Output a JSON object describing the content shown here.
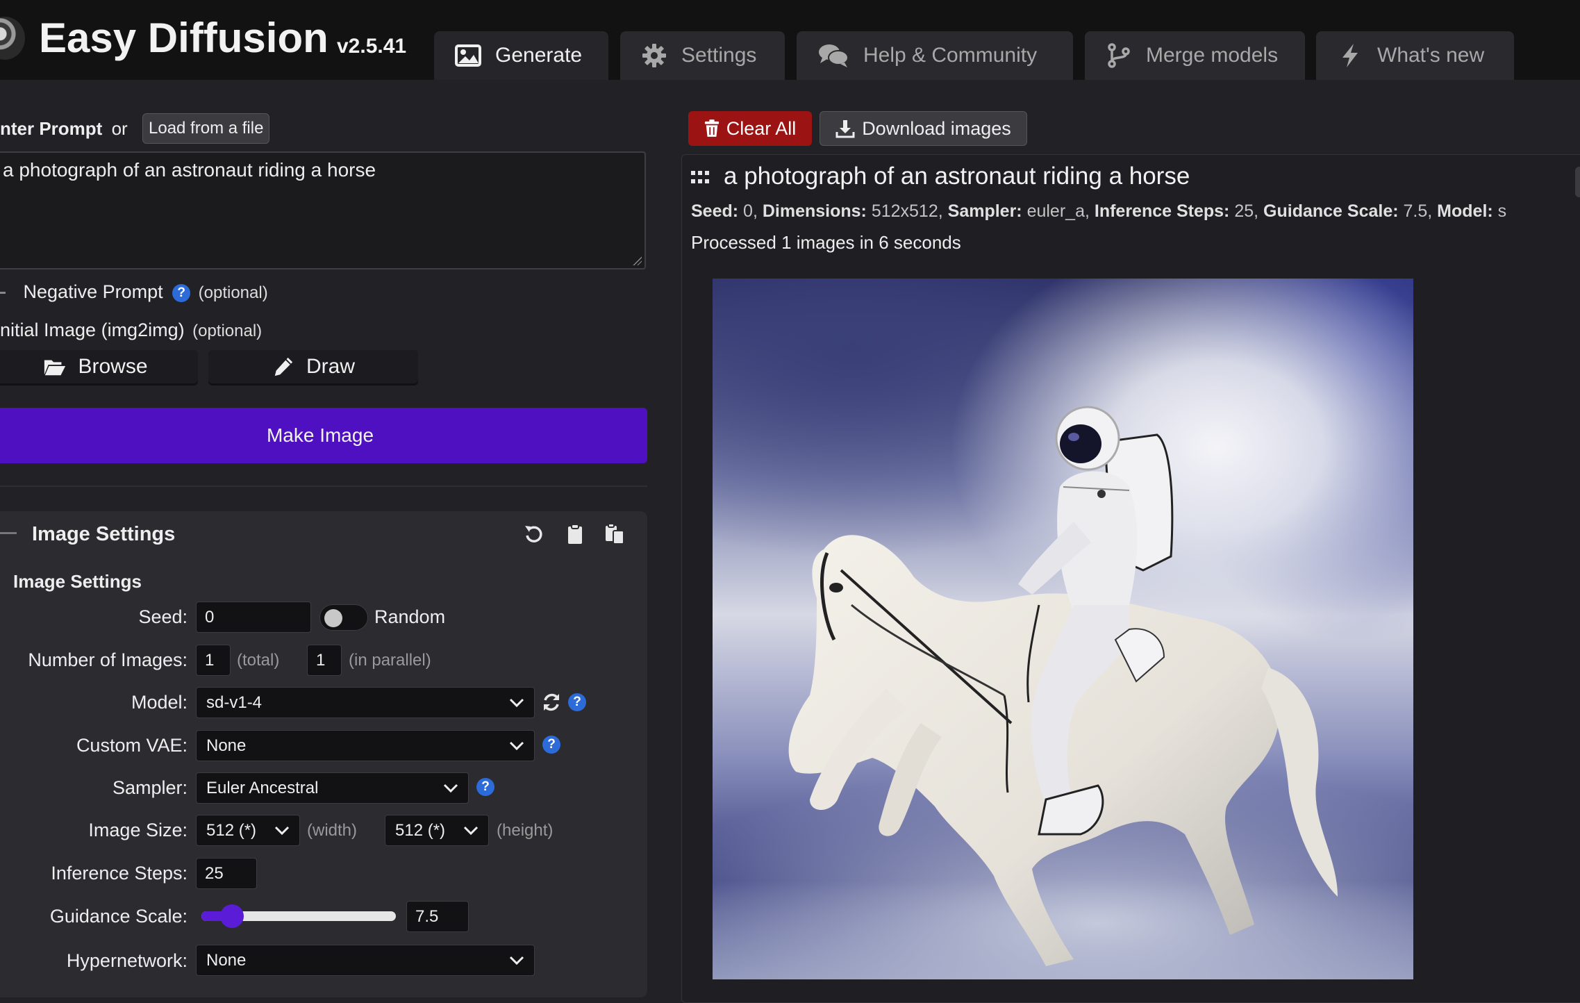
{
  "header": {
    "title": "Easy Diffusion",
    "version": "v2.5.41",
    "tabs": [
      {
        "label": "Generate",
        "icon": "image-icon",
        "active": true
      },
      {
        "label": "Settings",
        "icon": "gear-icon",
        "active": false
      },
      {
        "label": "Help & Community",
        "icon": "comments-icon",
        "active": false
      },
      {
        "label": "Merge models",
        "icon": "code-branch-icon",
        "active": false
      },
      {
        "label": "What's new",
        "icon": "bolt-icon",
        "active": false
      }
    ]
  },
  "prompt": {
    "label_bold": "nter Prompt",
    "label_or": "or",
    "load_button": "Load from a file",
    "value": "a photograph of an astronaut riding a horse"
  },
  "negative": {
    "label": "Negative Prompt",
    "help": "?",
    "optional": "(optional)"
  },
  "init_image": {
    "label": "nitial Image (img2img)",
    "optional": "(optional)",
    "browse": "Browse",
    "draw": "Draw"
  },
  "make_image": "Make Image",
  "image_settings": {
    "card_title": "Image Settings",
    "sub_title": "Image Settings",
    "seed": {
      "label": "Seed:",
      "value": "0",
      "random_label": "Random"
    },
    "num_images": {
      "label": "Number of Images:",
      "total": "1",
      "total_hint": "(total)",
      "parallel": "1",
      "parallel_hint": "(in parallel)"
    },
    "model": {
      "label": "Model:",
      "value": "sd-v1-4"
    },
    "vae": {
      "label": "Custom VAE:",
      "value": "None"
    },
    "sampler": {
      "label": "Sampler:",
      "value": "Euler Ancestral"
    },
    "image_size": {
      "label": "Image Size:",
      "width": "512 (*)",
      "width_hint": "(width)",
      "height": "512 (*)",
      "height_hint": "(height)"
    },
    "steps": {
      "label": "Inference Steps:",
      "value": "25"
    },
    "guidance": {
      "label": "Guidance Scale:",
      "value": "7.5",
      "slider_fraction": 0.13
    },
    "hypernetwork": {
      "label": "Hypernetwork:",
      "value": "None"
    }
  },
  "output": {
    "clear_all": "Clear All",
    "download": "Download images",
    "task_prompt": "a photograph of an astronaut riding a horse",
    "info": [
      {
        "k": "Seed:",
        "v": "0,"
      },
      {
        "k": "Dimensions:",
        "v": "512x512,"
      },
      {
        "k": "Sampler:",
        "v": "euler_a,"
      },
      {
        "k": "Inference Steps:",
        "v": "25,"
      },
      {
        "k": "Guidance Scale:",
        "v": "7.5,"
      },
      {
        "k": "Model:",
        "v": "s"
      }
    ],
    "status": "Processed 1 images in 6 seconds"
  },
  "colors": {
    "accent": "#4e10c0",
    "danger": "#9b1313",
    "help": "#2c6bd8",
    "bg": "#222226"
  }
}
